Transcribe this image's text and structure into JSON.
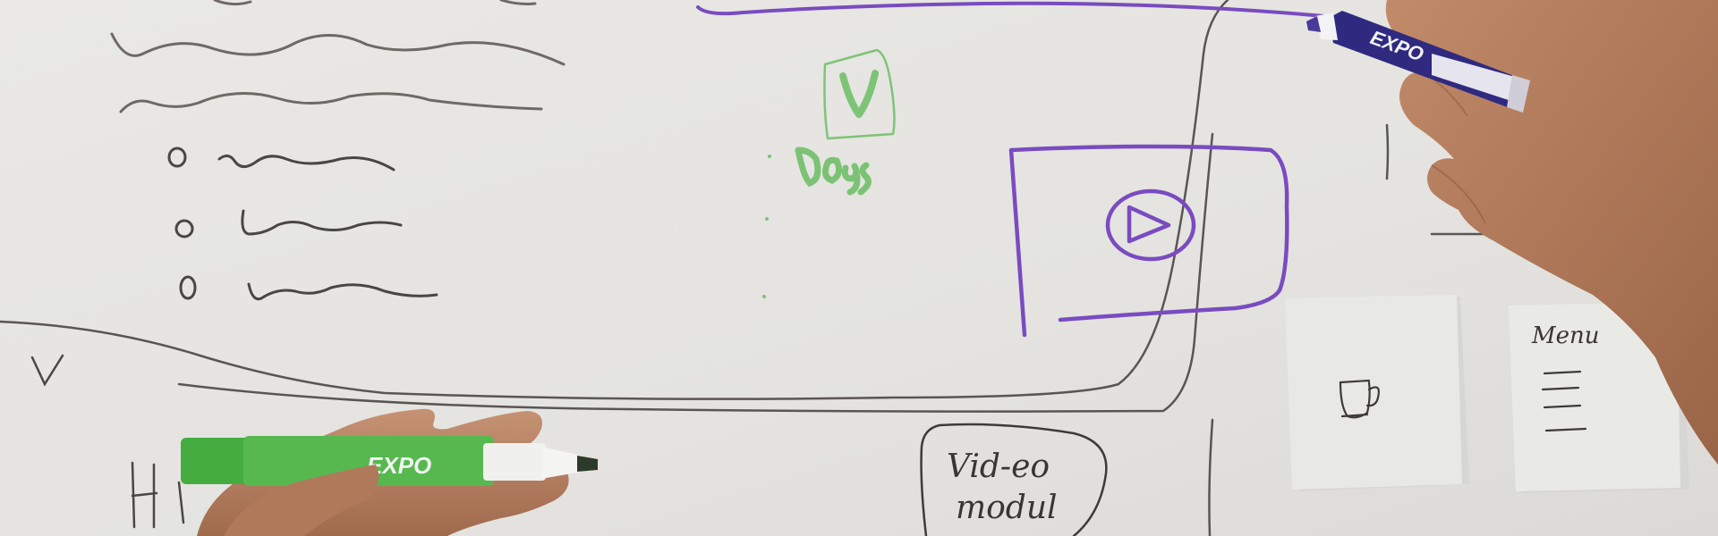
{
  "image": {
    "scene": "whiteboard-sketching-session",
    "colors": {
      "board": "#e6e5e2",
      "black_ink": "#4a4644",
      "purple_ink": "#7a4bc0",
      "green_ink": "#6fbf6a",
      "sticky_note": "#e9eae6",
      "skin": "#b07a5a",
      "marker_purple": "#3b2a8a",
      "marker_green": "#45b04a"
    },
    "handwriting": {
      "green_badge": "V",
      "green_word": "Dogs",
      "video_label_line1": "Vid-eo",
      "video_label_line2": "modul",
      "sticky_menu": "Menu",
      "left_letter_v": "V",
      "left_letters_h": "H",
      "purple_marker_brand": "EXPO",
      "green_marker_brand": "EXPO"
    }
  }
}
